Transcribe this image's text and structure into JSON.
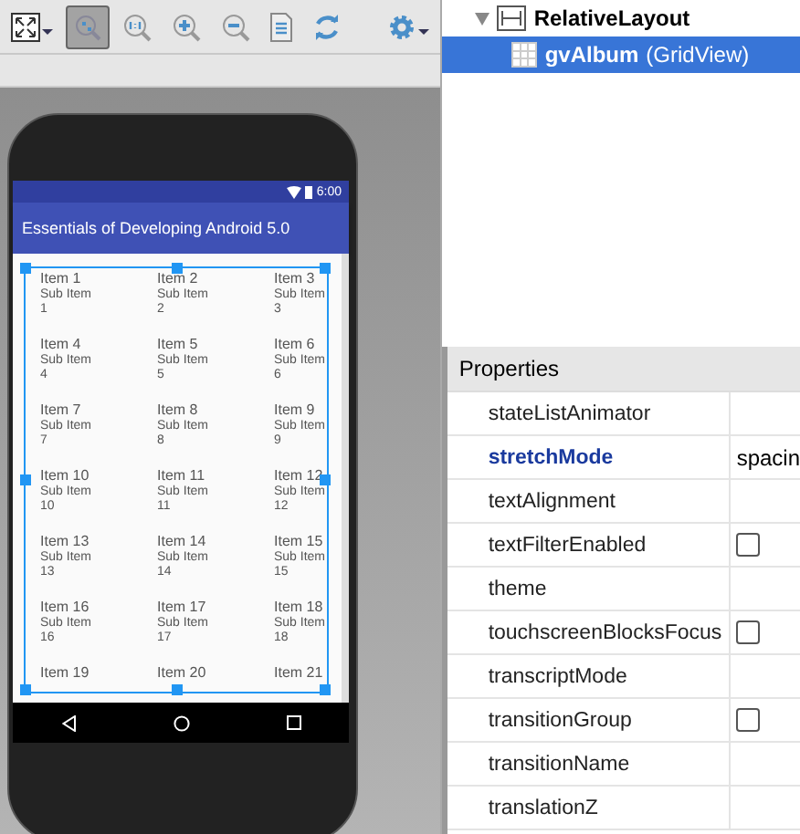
{
  "toolbar": {
    "items": [
      {
        "kind": "fit",
        "pressed": false
      },
      {
        "kind": "zoom-fit",
        "pressed": true
      },
      {
        "kind": "actual",
        "pressed": false
      },
      {
        "kind": "zoom-in",
        "pressed": false
      },
      {
        "kind": "zoom-out",
        "pressed": false
      },
      {
        "kind": "doc",
        "pressed": false
      },
      {
        "kind": "refresh",
        "pressed": false
      },
      {
        "kind": "gear",
        "pressed": false
      }
    ]
  },
  "phone": {
    "status_time": "6:00",
    "app_title": "Essentials of Developing Android 5.0",
    "grid": [
      {
        "title": "Item 1",
        "sub": "Sub Item 1"
      },
      {
        "title": "Item 2",
        "sub": "Sub Item 2"
      },
      {
        "title": "Item 3",
        "sub": "Sub Item 3"
      },
      {
        "title": "Item 4",
        "sub": "Sub Item 4"
      },
      {
        "title": "Item 5",
        "sub": "Sub Item 5"
      },
      {
        "title": "Item 6",
        "sub": "Sub Item 6"
      },
      {
        "title": "Item 7",
        "sub": "Sub Item 7"
      },
      {
        "title": "Item 8",
        "sub": "Sub Item 8"
      },
      {
        "title": "Item 9",
        "sub": "Sub Item 9"
      },
      {
        "title": "Item 10",
        "sub": "Sub Item 10"
      },
      {
        "title": "Item 11",
        "sub": "Sub Item 11"
      },
      {
        "title": "Item 12",
        "sub": "Sub Item 12"
      },
      {
        "title": "Item 13",
        "sub": "Sub Item 13"
      },
      {
        "title": "Item 14",
        "sub": "Sub Item 14"
      },
      {
        "title": "Item 15",
        "sub": "Sub Item 15"
      },
      {
        "title": "Item 16",
        "sub": "Sub Item 16"
      },
      {
        "title": "Item 17",
        "sub": "Sub Item 17"
      },
      {
        "title": "Item 18",
        "sub": "Sub Item 18"
      },
      {
        "title": "Item 19"
      },
      {
        "title": "Item 20"
      },
      {
        "title": "Item 21"
      }
    ]
  },
  "component_tree": [
    {
      "name": "RelativeLayout",
      "expanded": true,
      "selected": false,
      "children": [
        {
          "name": "gvAlbum",
          "type": "(GridView)",
          "selected": true
        }
      ]
    }
  ],
  "properties": {
    "title": "Properties",
    "rows": [
      {
        "name": "stateListAnimator",
        "kind": "text",
        "modified": false
      },
      {
        "name": "stretchMode",
        "kind": "text",
        "modified": true,
        "value": "spacin"
      },
      {
        "name": "textAlignment",
        "kind": "text",
        "modified": false
      },
      {
        "name": "textFilterEnabled",
        "kind": "checkbox",
        "modified": false,
        "checked": false
      },
      {
        "name": "theme",
        "kind": "text",
        "modified": false
      },
      {
        "name": "touchscreenBlocksFocus",
        "kind": "checkbox",
        "modified": false,
        "checked": false
      },
      {
        "name": "transcriptMode",
        "kind": "text",
        "modified": false
      },
      {
        "name": "transitionGroup",
        "kind": "checkbox",
        "modified": false,
        "checked": false
      },
      {
        "name": "transitionName",
        "kind": "text",
        "modified": false
      },
      {
        "name": "translationZ",
        "kind": "text",
        "modified": false
      }
    ]
  }
}
